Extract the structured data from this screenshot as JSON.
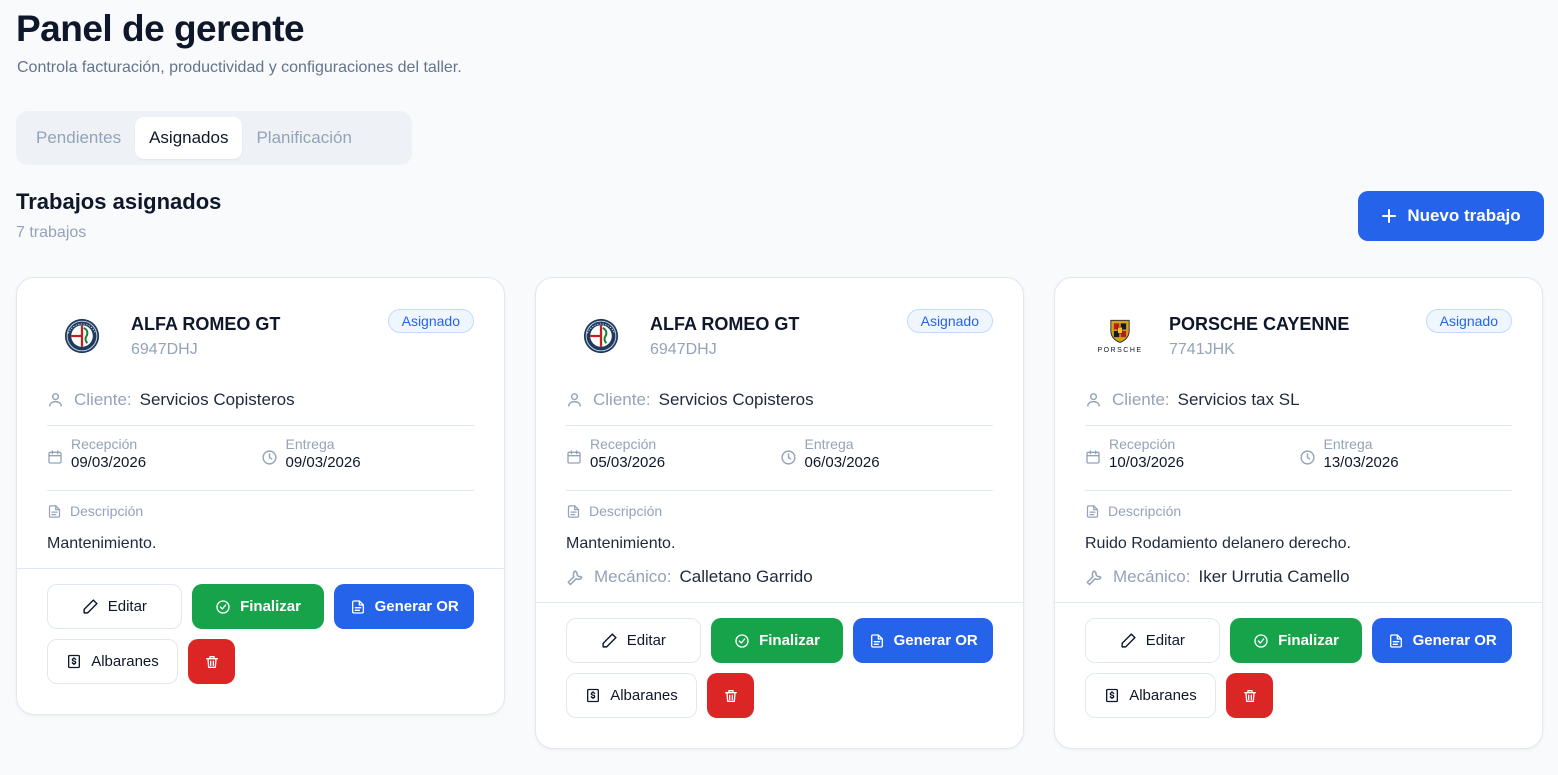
{
  "header": {
    "title": "Panel de gerente",
    "subtitle": "Controla facturación, productividad y configuraciones del taller."
  },
  "tabs": [
    {
      "label": "Pendientes",
      "active": false
    },
    {
      "label": "Asignados",
      "active": true
    },
    {
      "label": "Planificación",
      "active": false
    }
  ],
  "section": {
    "title": "Trabajos asignados",
    "count": "7 trabajos",
    "new_button": "Nuevo trabajo"
  },
  "labels": {
    "client": "Cliente:",
    "reception": "Recepción",
    "delivery": "Entrega",
    "description": "Descripción",
    "mechanic": "Mecánico:",
    "edit": "Editar",
    "finish": "Finalizar",
    "generate_or": "Generar OR",
    "delivery_notes": "Albaranes"
  },
  "colors": {
    "primary": "#2563eb",
    "success": "#16a34a",
    "danger": "#dc2626"
  },
  "cards": [
    {
      "brand_logo": "alfa-romeo-logo",
      "vehicle": "ALFA ROMEO GT",
      "plate": "6947DHJ",
      "status": "Asignado",
      "client": "Servicios Copisteros",
      "reception": "09/03/2026",
      "delivery": "09/03/2026",
      "description": "Mantenimiento.",
      "mechanic": ""
    },
    {
      "brand_logo": "alfa-romeo-logo",
      "vehicle": "ALFA ROMEO GT",
      "plate": "6947DHJ",
      "status": "Asignado",
      "client": "Servicios Copisteros",
      "reception": "05/03/2026",
      "delivery": "06/03/2026",
      "description": "Mantenimiento.",
      "mechanic": "Calletano Garrido"
    },
    {
      "brand_logo": "porsche-logo",
      "logo_text": "PORSCHE",
      "vehicle": "PORSCHE CAYENNE",
      "plate": "7741JHK",
      "status": "Asignado",
      "client": "Servicios tax SL",
      "reception": "10/03/2026",
      "delivery": "13/03/2026",
      "description": "Ruido Rodamiento delanero derecho.",
      "mechanic": "Iker Urrutia Camello"
    }
  ]
}
